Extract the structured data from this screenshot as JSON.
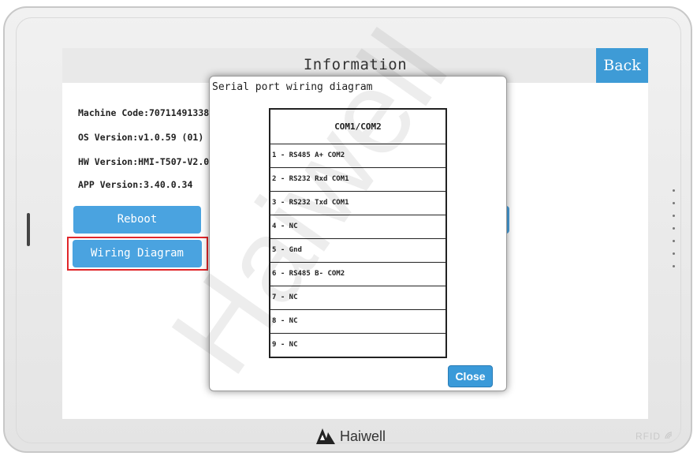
{
  "screen": {
    "title": "Information",
    "back_label": "Back"
  },
  "info": {
    "machine_code": "Machine Code:70711491338",
    "os_version": "OS Version:v1.0.59 (01)",
    "hw_version": "HW Version:HMI-T507-V2.0",
    "app_version": "APP Version:3.40.0.34"
  },
  "buttons": {
    "reboot": "Reboot",
    "wiring": "Wiring Diagram"
  },
  "modal": {
    "title": "Serial port wiring diagram",
    "table_header": "COM1/COM2",
    "rows": [
      "1 - RS485 A+ COM2",
      "2 - RS232 Rxd COM1",
      "3 - RS232 Txd COM1",
      "4 - NC",
      "5 - Gnd",
      "6 - RS485 B- COM2",
      "7 - NC",
      "8 - NC",
      "9 - NC"
    ],
    "close_label": "Close"
  },
  "brand": {
    "name": "Haiwell",
    "rfid": "RFID"
  },
  "watermark": {
    "text": "Haiwell"
  },
  "colors": {
    "accent": "#3e9bd6",
    "highlight": "#e0262a"
  },
  "icons": {
    "logo": "haiwell-logo-icon",
    "rfid": "rfid-icon"
  }
}
